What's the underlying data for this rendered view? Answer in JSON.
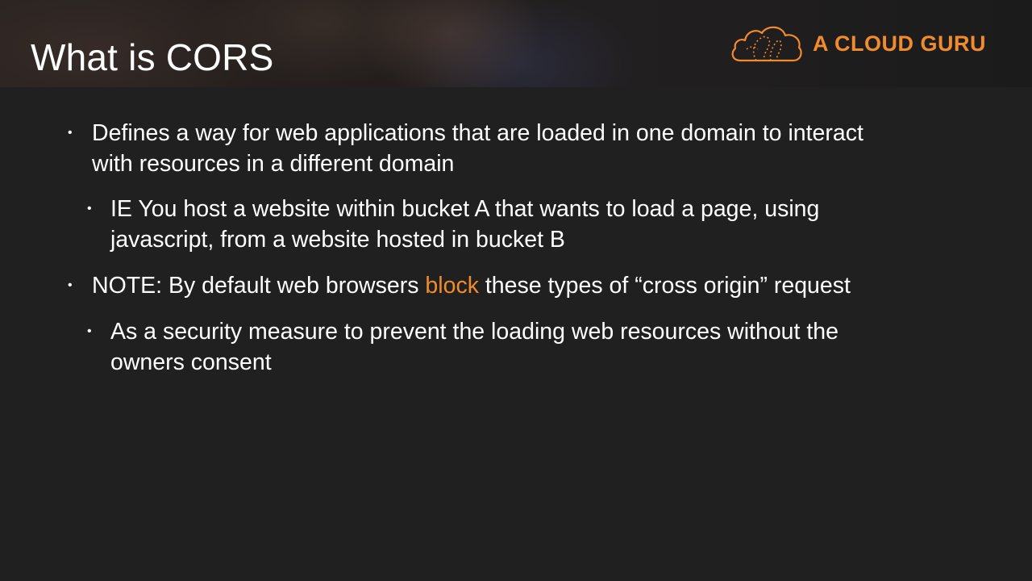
{
  "slide": {
    "title": "What is CORS",
    "logo_text": "A CLOUD GURU",
    "bullets": {
      "b1": {
        "line1": "Defines a way for web applications that are loaded in one domain to interact",
        "line2": "with resources in a different domain"
      },
      "b1_sub": {
        "line1": "IE You host a website within bucket A that wants to load a page, using",
        "line2": "javascript, from a website hosted in bucket B"
      },
      "b2": {
        "before": "NOTE: By default web browsers ",
        "highlight": "block",
        "after": " these types of “cross origin” request"
      },
      "b2_sub": {
        "line1": "As a security measure to prevent the loading web resources without the",
        "line2": "owners consent"
      },
      "bullet_glyph": "•"
    }
  },
  "colors": {
    "accent": "#f28b2c",
    "background": "#202020",
    "text": "#ffffff"
  },
  "icons": {
    "logo": "cloud-logo-icon"
  }
}
